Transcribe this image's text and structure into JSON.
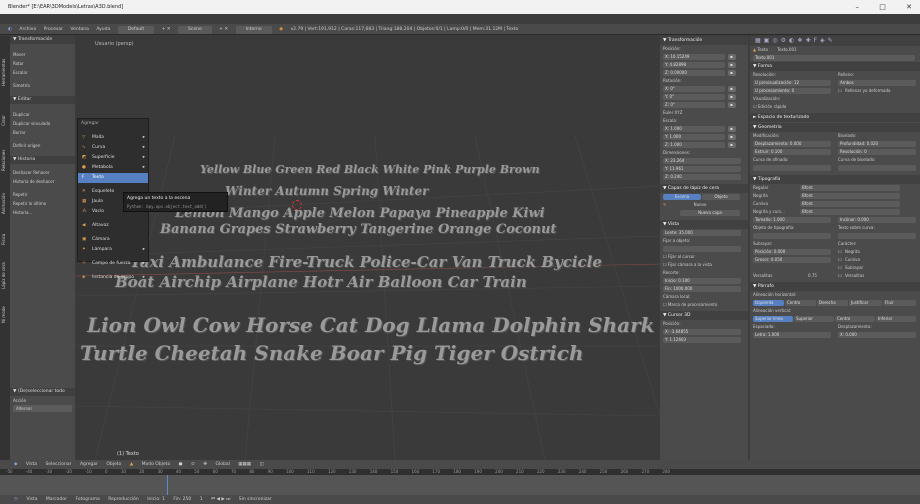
{
  "window": {
    "title": "Blender* [E:\\EAR\\3DModels\\Letras\\A3D.blend]",
    "minimize": "–",
    "maximize": "□",
    "close": "✕"
  },
  "header": {
    "menu": [
      "Archivo",
      "Procesar",
      "Ventana",
      "Ayuda"
    ],
    "layout": "Default",
    "scene": "Scene",
    "engine": "Interno",
    "stats": "v2.79 | Vert:191,912 | Caras:117,683 | Triang:188,204 | Objetos:0/1 | Lamp:0/0 | Mem:31.12M | Texto"
  },
  "tool_tabs": [
    "Herramientas",
    "Crear",
    "Relaciones",
    "Animación",
    "Física",
    "Lápiz de cera",
    "Ni mode"
  ],
  "left_panel": {
    "transform": {
      "title": "▼ Transformación",
      "items": [
        "Mover",
        "Rotar",
        "Escalar",
        "Simetría"
      ]
    },
    "edit": {
      "title": "▼ Editar",
      "items": [
        "Duplicar",
        "Duplicar vinculado",
        "Borrar",
        "Definir origen"
      ]
    },
    "history": {
      "title": "▼ Historia",
      "items": [
        "Deshacer  Rehacer",
        "Historia de deshacer",
        "Repetir",
        "Repetir lo último",
        "Historia..."
      ]
    },
    "operator": {
      "title": "▼ (De)seleccionar todo",
      "label": "Acción",
      "value": "Alternar"
    }
  },
  "viewport": {
    "view_label": "Usuario (persp)",
    "object_label": "(1) Texto",
    "lines": [
      "Yellow Blue Green Red Black White Pink Purple Brown",
      "Winter Autumn Spring Winter",
      "Lemon Mango Apple Melon Papaya Pineapple Kiwi",
      "Banana Grapes Strawberry Tangerine Orange Coconut",
      "Taxi Ambulance Fire-Truck Police-Car Van Truck Bycicle",
      "Boat Airchip Airplane Hotr Air Balloon Car Train",
      "Lion Owl Cow Horse Cat Dog Llama Dolphin Shark",
      "Turtle Cheetah Snake Boar Pig Tiger Ostrich"
    ]
  },
  "add_menu": {
    "title": "Agregar",
    "items": [
      "Malla",
      "Curva",
      "Superficie",
      "Metabola",
      "Texto",
      "Esqueleto",
      "Jaula",
      "Vacío",
      "Altavoz",
      "Cámara",
      "Lámpara",
      "Campo de fuerza",
      "Instancia de grupo"
    ],
    "selected": "Texto"
  },
  "tooltip": {
    "line1": "Agrega un texto a la escena",
    "line2": "Python: bpy.ops.object.text_add()"
  },
  "props1": {
    "transform_title": "▼ Transformación",
    "location_label": "Posición:",
    "location": [
      "X:  10.15249",
      "Y:  4.82898",
      "Z:  0.00000"
    ],
    "rotation_label": "Rotación:",
    "rotation": [
      "X:  0°",
      "Y:  0°",
      "Z:  0°"
    ],
    "euler": "Euler XYZ",
    "scale_label": "Escala:",
    "scale": [
      "X:  1.000",
      "Y:  1.000",
      "Z:  1.000"
    ],
    "dim_label": "Dimensiones:",
    "dims": [
      "X:  23.264",
      "Y:  11.961",
      "Z:  0.240"
    ],
    "grease": "▼ Capas de lápiz de cera",
    "grease_tabs": [
      "Escena",
      "Objeto"
    ],
    "new": "Nuevo",
    "new_layer": "Nueva capa",
    "view_title": "▼ Vista",
    "lens": "Lente: 35.000",
    "lock": "Fijar a objeto:",
    "cursor_lock": "Fijar al cursor",
    "cam_lock": "Fijar cámara a la vista",
    "clip_label": "Recorte:",
    "clip_start": "Inicio: 0.100",
    "clip_end": "Fin: 1000.000",
    "local_cam": "Cámara local:",
    "render_border": "Marco de procesamiento",
    "cursor_title": "▼ Cursor 3D",
    "cursor_pos": "Posición:",
    "cursor": [
      "X:  -3.64855",
      "Y:  1.12603",
      "Z:  0.07020"
    ]
  },
  "props2": {
    "object": "Texto",
    "data": "Texto.001",
    "name_field": "Texto.001",
    "shape_title": "▼ Forma",
    "resolution": "Resolución:",
    "fill": "Relleno:",
    "preview_u": "U previsualización:  12",
    "render_u": "U procesamiento:  0",
    "fill_mode": "Ambos",
    "fill_deform": "Rellenar yo deformada",
    "display": "Visualización:",
    "fast": "Edición rápida",
    "texspace": "► Espacio de texturizado",
    "geometry_title": "▼ Geometría",
    "modification": "Modificación:",
    "bevel": "Biselado:",
    "offset": "Desplazamiento: 0.000",
    "extrude": "Extruir: 0.100",
    "depth": "Profundidad: 0.020",
    "bev_res": "Resolución: 0",
    "taper": "Curva de afinado:",
    "bev_obj": "Curva de biselado:",
    "font_title": "▼ Tipografía",
    "fonts": [
      "Regular",
      "Negrita",
      "Cursiva",
      "Negrita y curs..."
    ],
    "font_value": "Bfont",
    "size": "Tamaño: 1.000",
    "shear": "Inclinar: 0.000",
    "font_obj": "Objeto de tipografía:",
    "text_curve": "Texto sobre curva:",
    "underline": "Subrayar:",
    "ul_pos": "Posición: 0.000",
    "ul_thick": "Grosor: 0.050",
    "character": "Carácter:",
    "bold": "Negrita",
    "italic": "Cursiva",
    "ul": "Subrayar",
    "smallcaps": "Versalitas",
    "smallcaps_val": "0.75",
    "versalitas": "Versalitas",
    "paragraph_title": "▼ Párrafo",
    "h_align": "Alineación horizontal:",
    "h_opts": [
      "Izquierda",
      "Centro",
      "Derecha",
      "Justificar",
      "Fluir"
    ],
    "v_align": "Alineación vertical:",
    "v_opts": [
      "Superior línea",
      "Superior",
      "Centro",
      "Inferior"
    ],
    "spacing": "Espaciado:",
    "displacement": "Desplazamiento:",
    "sp": [
      "Letra: 1.000",
      "Palabra: 1.000",
      "Línea: 0.000"
    ],
    "dp": [
      "X: 0.000",
      "Y: 0.000"
    ]
  },
  "bottom": {
    "view_bar": [
      "Vista",
      "Seleccionar",
      "Agregar",
      "Objeto",
      "Modo Objeto",
      "Global"
    ],
    "ruler": "-50 -40 -30 -20 -10 0 10 20 30 40 50 60 70 80 90 100 110 120 130 140 150 160 170 180 190 200 210 220 230 240 250 260 270 280",
    "timeline_bar": [
      "Vista",
      "Marcador",
      "Fotograma",
      "Reproducción",
      "Inicio: 1",
      "Fin: 250",
      "1",
      "Sin sincronizar"
    ]
  }
}
